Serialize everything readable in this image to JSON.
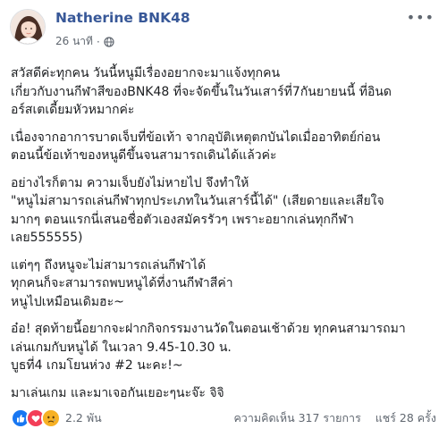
{
  "post": {
    "author": "Natherine BNK48",
    "time": "26 นาที",
    "privacy_icon": "globe-icon",
    "more_icon": "more-options-icon",
    "paragraphs": [
      [
        "สวัสดีค่ะทุกคน วันนี้หนูมีเรื่องอยากจะมาแจ้งทุกคน",
        "เกี่ยวกับงานกีฬาสีของBNK48 ที่จะจัดขึ้นในวันเสาร์ที่7กันยายนนี้ ที่อินด",
        "อร์สเตเดี้ยมหัวหมากค่ะ"
      ],
      [
        "เนื่องจากอาการบาดเจ็บที่ข้อเท้า จากอุบัติเหตุตกบันไดเมื่ออาทิตย์ก่อน",
        "ตอนนี้ข้อเท้าของหนูดีขึ้นจนสามารถเดินได้แล้วค่ะ"
      ],
      [
        "อย่างไรก็ตาม ความเจ็บยังไม่หายไป จึงทำให้",
        "\"หนูไม่สามารถเล่นกีฬาทุกประเภทในวันเสาร์นี้ได้\" (เสียดายและเสียใจ",
        "มากๆ ตอนแรกนี่เสนอชื่อตัวเองสมัครรัวๆ เพราะอยากเล่นทุกกีฬา",
        "เลย555555)"
      ],
      [
        "แต่ๆๆ ถึงหนูจะไม่สามารถเล่นกีฬาได้",
        "ทุกคนก็จะสามารถพบหนูได้ที่งานกีฬาสีค่า",
        "หนูไปเหมือนเดิมฮะ~"
      ],
      [
        "อ๋อ! สุดท้ายนี้อยากจะฝากกิจกรรมงานวัดในตอนเช้าด้วย ทุกคนสามารถมา",
        "เล่นเกมกับหนูได้ ในเวลา 9.45-10.30 น.",
        "บูธที่4 เกมโยนห่วง #2 นะคะ!~"
      ],
      [
        "มาเล่นเกม และมาเจอกันเยอะๆนะจ๊ะ จิจิ"
      ]
    ]
  },
  "footer": {
    "reactions": [
      "like",
      "love",
      "sad"
    ],
    "reaction_count": "2.2 พัน",
    "comments": "ความคิดเห็น 317 รายการ",
    "shares": "แชร์ 28 ครั้ง"
  },
  "colors": {
    "author": "#385898",
    "meta": "#606770",
    "like": "#1877f2",
    "love": "#f33e58",
    "sad": "#f7b125"
  }
}
